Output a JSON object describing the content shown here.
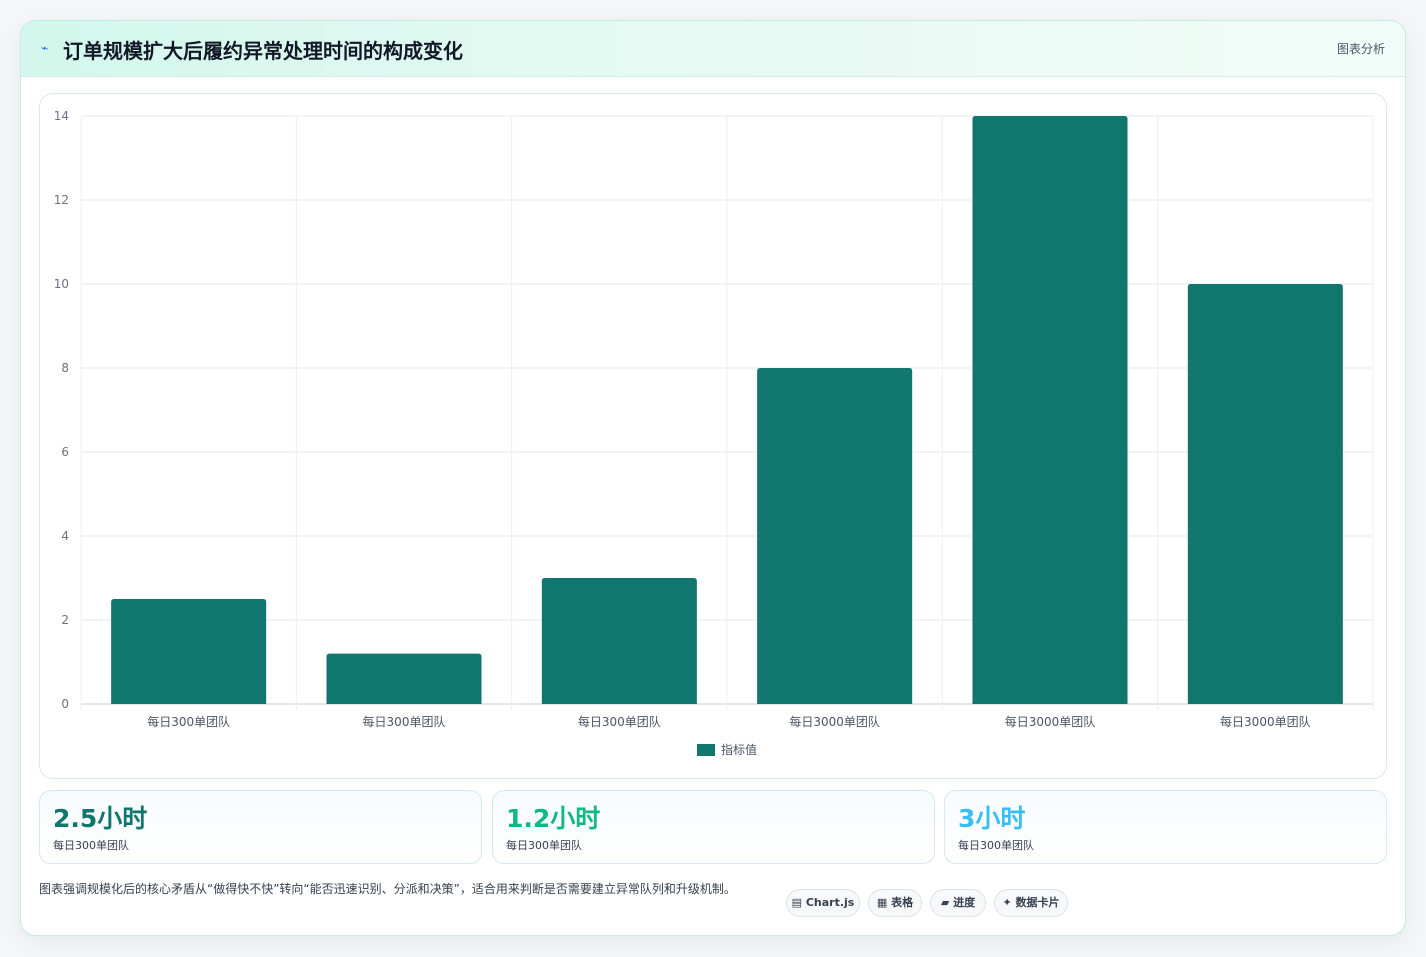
{
  "header": {
    "icon": "sparkline-icon",
    "title": "订单规模扩大后履约异常处理时间的构成变化",
    "tag": "图表分析"
  },
  "chart_data": {
    "type": "bar",
    "categories": [
      "每日300单团队",
      "每日300单团队",
      "每日300单团队",
      "每日3000单团队",
      "每日3000单团队",
      "每日3000单团队"
    ],
    "series": [
      {
        "name": "指标值",
        "values": [
          2.5,
          1.2,
          3,
          8,
          14,
          10
        ]
      }
    ],
    "ylim": [
      0,
      14
    ],
    "yticks": [
      0,
      2,
      4,
      6,
      8,
      10,
      12,
      14
    ],
    "grid": true,
    "legend_position": "bottom",
    "bar_color": "#10766e"
  },
  "stats": [
    {
      "value": "2.5小时",
      "label": "每日300单团队",
      "color": "#0f766e"
    },
    {
      "value": "1.2小时",
      "label": "每日300单团队",
      "color": "#10b981"
    },
    {
      "value": "3小时",
      "label": "每日300单团队",
      "color": "#38bdf8"
    }
  ],
  "note": "图表强调规模化后的核心矛盾从“做得快不快”转向“能否迅速识别、分派和决策”，适合用来判断是否需要建立异常队列和升级机制。",
  "pills": [
    {
      "icon": "chart-icon",
      "label": "▤ Chart.js"
    },
    {
      "icon": "table-icon",
      "label": "▦ 表格"
    },
    {
      "icon": "progress-icon",
      "label": "▰ 进度"
    },
    {
      "icon": "card-icon",
      "label": "✦ 数据卡片"
    }
  ]
}
